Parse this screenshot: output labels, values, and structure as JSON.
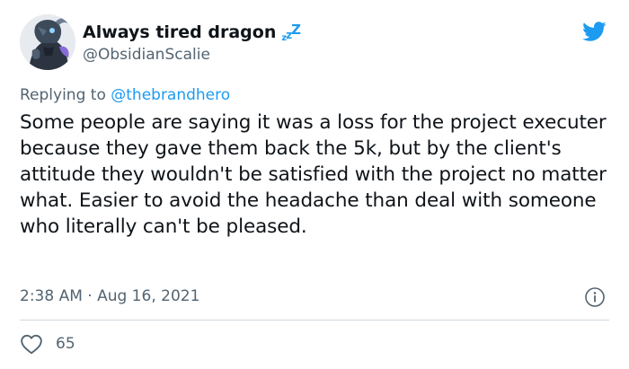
{
  "author": {
    "display_name": "Always tired dragon",
    "name_emoji": "zzZ",
    "handle": "@ObsidianScalie"
  },
  "reply": {
    "prefix": "Replying to ",
    "mention": "@thebrandhero"
  },
  "tweet": {
    "text": "Some people are saying it was a loss for the project executer because they gave them back the 5k, but by the client's attitude they wouldn't be satisfied with the project no matter what. Easier to avoid the headache than deal with someone who literally can't be pleased.",
    "timestamp": "2:38 AM · Aug 16, 2021"
  },
  "engagement": {
    "likes": "65"
  },
  "colors": {
    "twitter_blue": "#1d9bf0",
    "secondary_text": "#536471",
    "divider": "#cfd9de"
  },
  "icons": {
    "brand": "twitter-bird-icon",
    "info": "info-icon",
    "like": "heart-icon",
    "sleep_emoji": "zzz-icon"
  }
}
